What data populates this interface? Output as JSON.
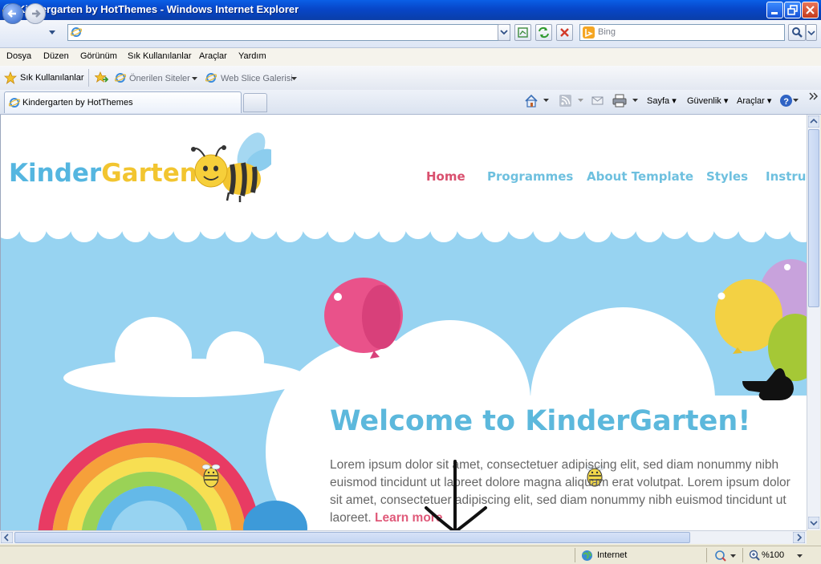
{
  "window": {
    "title": "Kindergarten by HotThemes - Windows Internet Explorer"
  },
  "addressbar": {
    "url": "",
    "search_placeholder": "Bing"
  },
  "menubar": {
    "items": [
      "Dosya",
      "Düzen",
      "Görünüm",
      "Sık Kullanılanlar",
      "Araçlar",
      "Yardım"
    ]
  },
  "favbar": {
    "favorites_label": "Sık Kullanılanlar",
    "suggested_sites": "Önerilen Siteler",
    "web_slice": "Web Slice Galerisi"
  },
  "tabs": {
    "active_label": "Kindergarten by HotThemes"
  },
  "commandbar": {
    "page": "Sayfa",
    "safety": "Güvenlik",
    "tools": "Araçlar"
  },
  "site": {
    "logo_part1": "Kinder",
    "logo_part2": "Garten",
    "nav": [
      "Home",
      "Programmes",
      "About Template",
      "Styles",
      "Instructions"
    ],
    "welcome_title": "Welcome to KinderGarten!",
    "body_text": "Lorem ipsum dolor sit amet, consectetuer adipiscing elit, sed diam nonummy nibh euismod tincidunt ut laoreet dolore magna aliquam erat volutpat. Lorem ipsum dolor sit amet, consectetuer adipiscing elit, sed diam nonummy nibh euismod tincidunt ut laoreet.",
    "learn_more": "Learn more"
  },
  "statusbar": {
    "zone": "Internet",
    "zoom": "%100"
  },
  "colors": {
    "sky": "#97d3f1",
    "nav_active": "#d9506e",
    "nav": "#6ec0df",
    "title_blue": "#5cb8dc"
  },
  "icons": [
    "ie-icon",
    "back-icon",
    "forward-icon",
    "refresh-icon",
    "stop-icon",
    "bing-icon",
    "search-icon",
    "star-icon",
    "home-icon",
    "rss-icon",
    "mail-icon",
    "print-icon",
    "help-icon",
    "globe-icon",
    "zoom-icon"
  ]
}
